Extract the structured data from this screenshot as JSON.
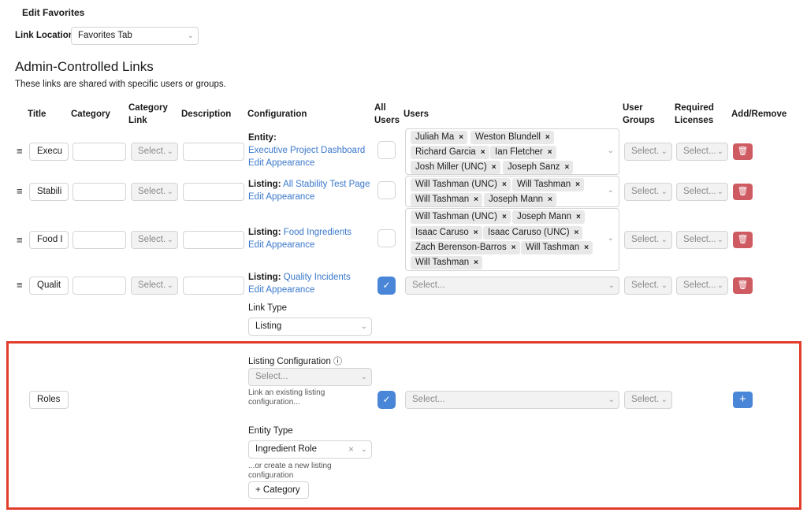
{
  "page_title": "Edit Favorites",
  "link_location": {
    "label": "Link Location",
    "value": "Favorites Tab"
  },
  "section": {
    "title": "Admin-Controlled Links",
    "subtitle": "These links are shared with specific users or groups."
  },
  "columns": {
    "title": "Title",
    "category": "Category",
    "category_link": "Category Link",
    "description": "Description",
    "configuration": "Configuration",
    "all_users": "All Users",
    "users": "Users",
    "user_groups": "User Groups",
    "required_licenses": "Required Licenses",
    "add_remove": "Add/Remove"
  },
  "select_placeholder": "Select...",
  "select_short": "Select.",
  "edit_appearance": "Edit Appearance",
  "rows": [
    {
      "title": "Execu",
      "config_label": "Entity:",
      "config_link": "Executive Project Dashboard",
      "all_users": false,
      "users": [
        "Juliah Ma",
        "Weston Blundell",
        "Richard Garcia",
        "Ian Fletcher",
        "Josh Miller (UNC)",
        "Joseph Sanz"
      ]
    },
    {
      "title": "Stabili",
      "config_label": "Listing:",
      "config_link": "All Stability Test Page",
      "all_users": false,
      "users": [
        "Will Tashman (UNC)",
        "Will Tashman",
        "Will Tashman",
        "Joseph Mann"
      ]
    },
    {
      "title": "Food I",
      "config_label": "Listing:",
      "config_link": "Food Ingredients",
      "all_users": false,
      "users": [
        "Will Tashman (UNC)",
        "Joseph Mann",
        "Isaac Caruso",
        "Isaac Caruso (UNC)",
        "Zach Berenson-Barros",
        "Will Tashman",
        "Will Tashman"
      ]
    },
    {
      "title": "Qualit",
      "config_label": "Listing:",
      "config_link": "Quality Incidents",
      "all_users": true,
      "users": []
    }
  ],
  "link_type": {
    "label": "Link Type",
    "value": "Listing"
  },
  "new_row": {
    "title": "Roles",
    "listing_configuration_label": "Listing Configuration",
    "listing_configuration_help": "Link an existing listing configuration...",
    "entity_type_label": "Entity Type",
    "entity_type_value": "Ingredient Role",
    "create_help": "...or create a new listing configuration",
    "category_button": "Category",
    "all_users": true
  },
  "colors": {
    "accent": "#4a86d8",
    "link": "#3a78cc",
    "danger": "#cf5b62",
    "highlight": "#e23c2b"
  },
  "icons": {
    "drag": "drag-handle-icon",
    "delete": "trash-icon",
    "add": "plus-icon",
    "check": "check-icon",
    "info": "info-icon",
    "chevron": "chevron-down-icon",
    "clear": "close-icon"
  }
}
